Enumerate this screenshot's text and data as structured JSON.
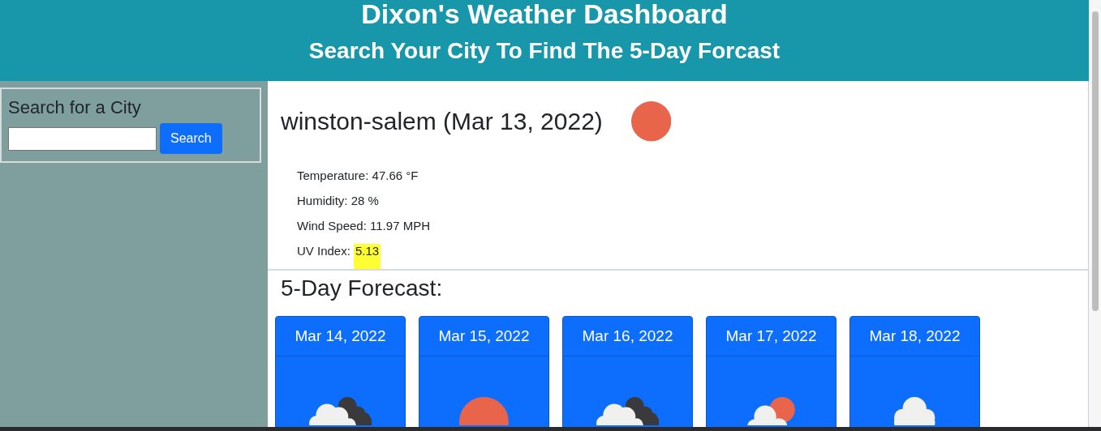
{
  "header": {
    "title": "Dixon's Weather Dashboard",
    "subtitle": "Search Your City To Find The 5-Day Forcast"
  },
  "search": {
    "heading": "Search for a City",
    "button": "Search"
  },
  "current": {
    "title": "winston-salem (Mar 13, 2022)",
    "kind": "clear",
    "details": [
      {
        "label": "Temperature: 47.66 °F"
      },
      {
        "label": "Humidity: 28 %"
      },
      {
        "label": "Wind Speed: 11.97 MPH"
      }
    ],
    "uv": {
      "label": "UV Index:",
      "value": "5.13"
    }
  },
  "forecast": {
    "heading": "5-Day Forecast:",
    "days": [
      {
        "date": "Mar 14, 2022",
        "kind": "broken-clouds"
      },
      {
        "date": "Mar 15, 2022",
        "kind": "clear"
      },
      {
        "date": "Mar 16, 2022",
        "kind": "broken-clouds"
      },
      {
        "date": "Mar 17, 2022",
        "kind": "partly-cloudy"
      },
      {
        "date": "Mar 18, 2022",
        "kind": "cloudy"
      }
    ]
  }
}
